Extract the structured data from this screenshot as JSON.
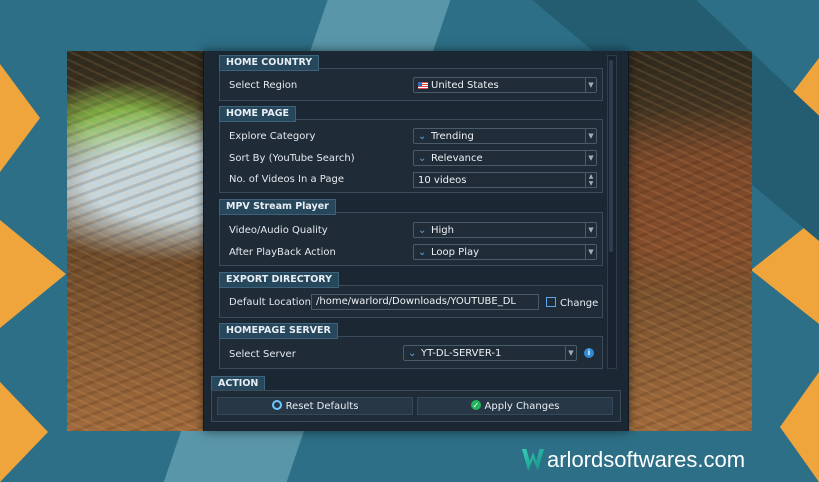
{
  "home_country": {
    "title": "HOME COUNTRY",
    "region_label": "Select Region",
    "region_value": "United States"
  },
  "home_page": {
    "title": "HOME PAGE",
    "explore_label": "Explore Category",
    "explore_value": "Trending",
    "sort_label": "Sort By (YouTube Search)",
    "sort_value": "Relevance",
    "videos_label": "No. of Videos In a Page",
    "videos_value": "10 videos"
  },
  "mpv": {
    "title": "MPV Stream Player",
    "quality_label": "Video/Audio Quality",
    "quality_value": "High",
    "after_label": "After PlayBack Action",
    "after_value": "Loop Play"
  },
  "export": {
    "title": "EXPORT DIRECTORY",
    "default_label": "Default Location",
    "path_value": "/home/warlord/Downloads/YOUTUBE_DL",
    "change_label": "Change"
  },
  "server": {
    "title": "HOMEPAGE SERVER",
    "select_label": "Select Server",
    "select_value": "YT-DL-SERVER-1"
  },
  "action": {
    "title": "ACTION",
    "reset_label": "Reset Defaults",
    "apply_label": "Apply Changes"
  },
  "brand": {
    "text": "arlordsoftwares.com"
  },
  "colors": {
    "accent": "#5aa6e8",
    "panel": "#1b2733",
    "orange": "#f0a43c",
    "teal": "#2d6f86"
  },
  "icons": {
    "dropdown": "chevron-down-icon",
    "spinner": "spinner-icon",
    "change": "folder-change-icon",
    "reset": "reset-icon",
    "apply": "check-circle-icon",
    "info": "info-icon"
  }
}
